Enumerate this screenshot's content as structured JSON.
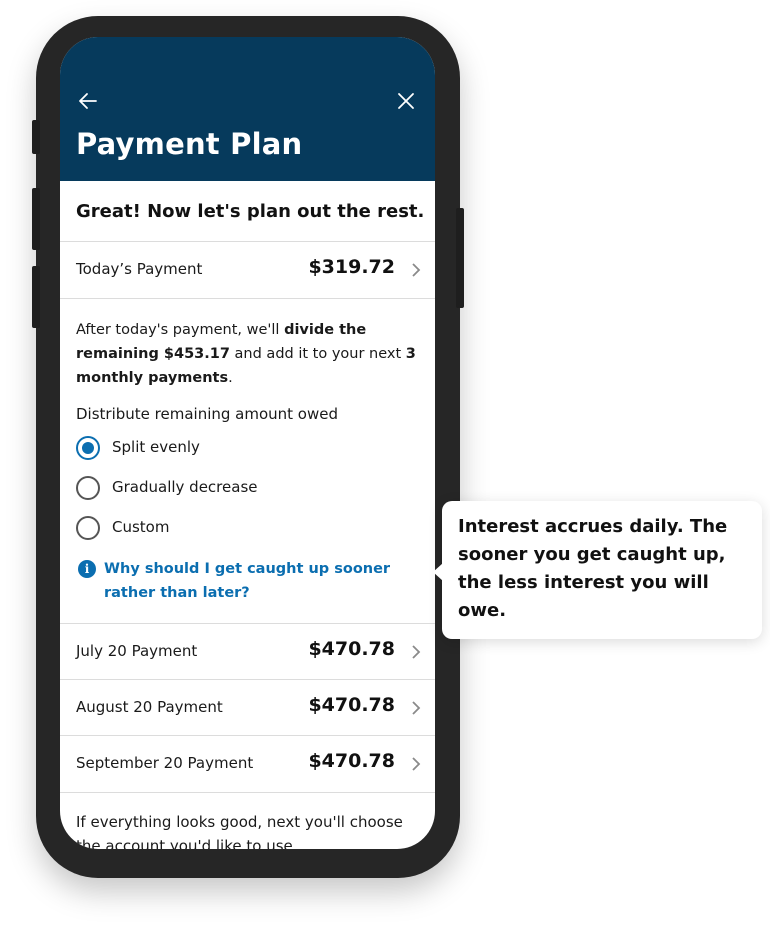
{
  "header": {
    "title": "Payment Plan",
    "bg_color": "#063a5c",
    "back_icon": "arrow-left-icon",
    "close_icon": "close-icon"
  },
  "subtitle": "Great! Now let's plan out the rest.",
  "todays_payment": {
    "label": "Today’s Payment",
    "amount": "$319.72"
  },
  "description": {
    "p1": "After today's payment, we'll ",
    "b1": "divide the remaining $453.17",
    "p2": " and add it to your next ",
    "b2": "3 monthly payments",
    "p3": "."
  },
  "distribute": {
    "label": "Distribute remaining amount owed",
    "options": [
      {
        "label": "Split evenly",
        "selected": true
      },
      {
        "label": "Gradually decrease",
        "selected": false
      },
      {
        "label": "Custom",
        "selected": false
      }
    ]
  },
  "info_link": "Why should I get caught up sooner rather than later?",
  "payments": [
    {
      "label": "July 20 Payment",
      "amount": "$470.78"
    },
    {
      "label": "August 20 Payment",
      "amount": "$470.78"
    },
    {
      "label": "September 20 Payment",
      "amount": "$470.78"
    }
  ],
  "footer_text": "If everything looks good, next you'll choose the account you'd like to use.",
  "tooltip": "Interest accrues daily. The sooner you get caught up, the less interest you will owe.",
  "accent_color": "#0b6eb0"
}
